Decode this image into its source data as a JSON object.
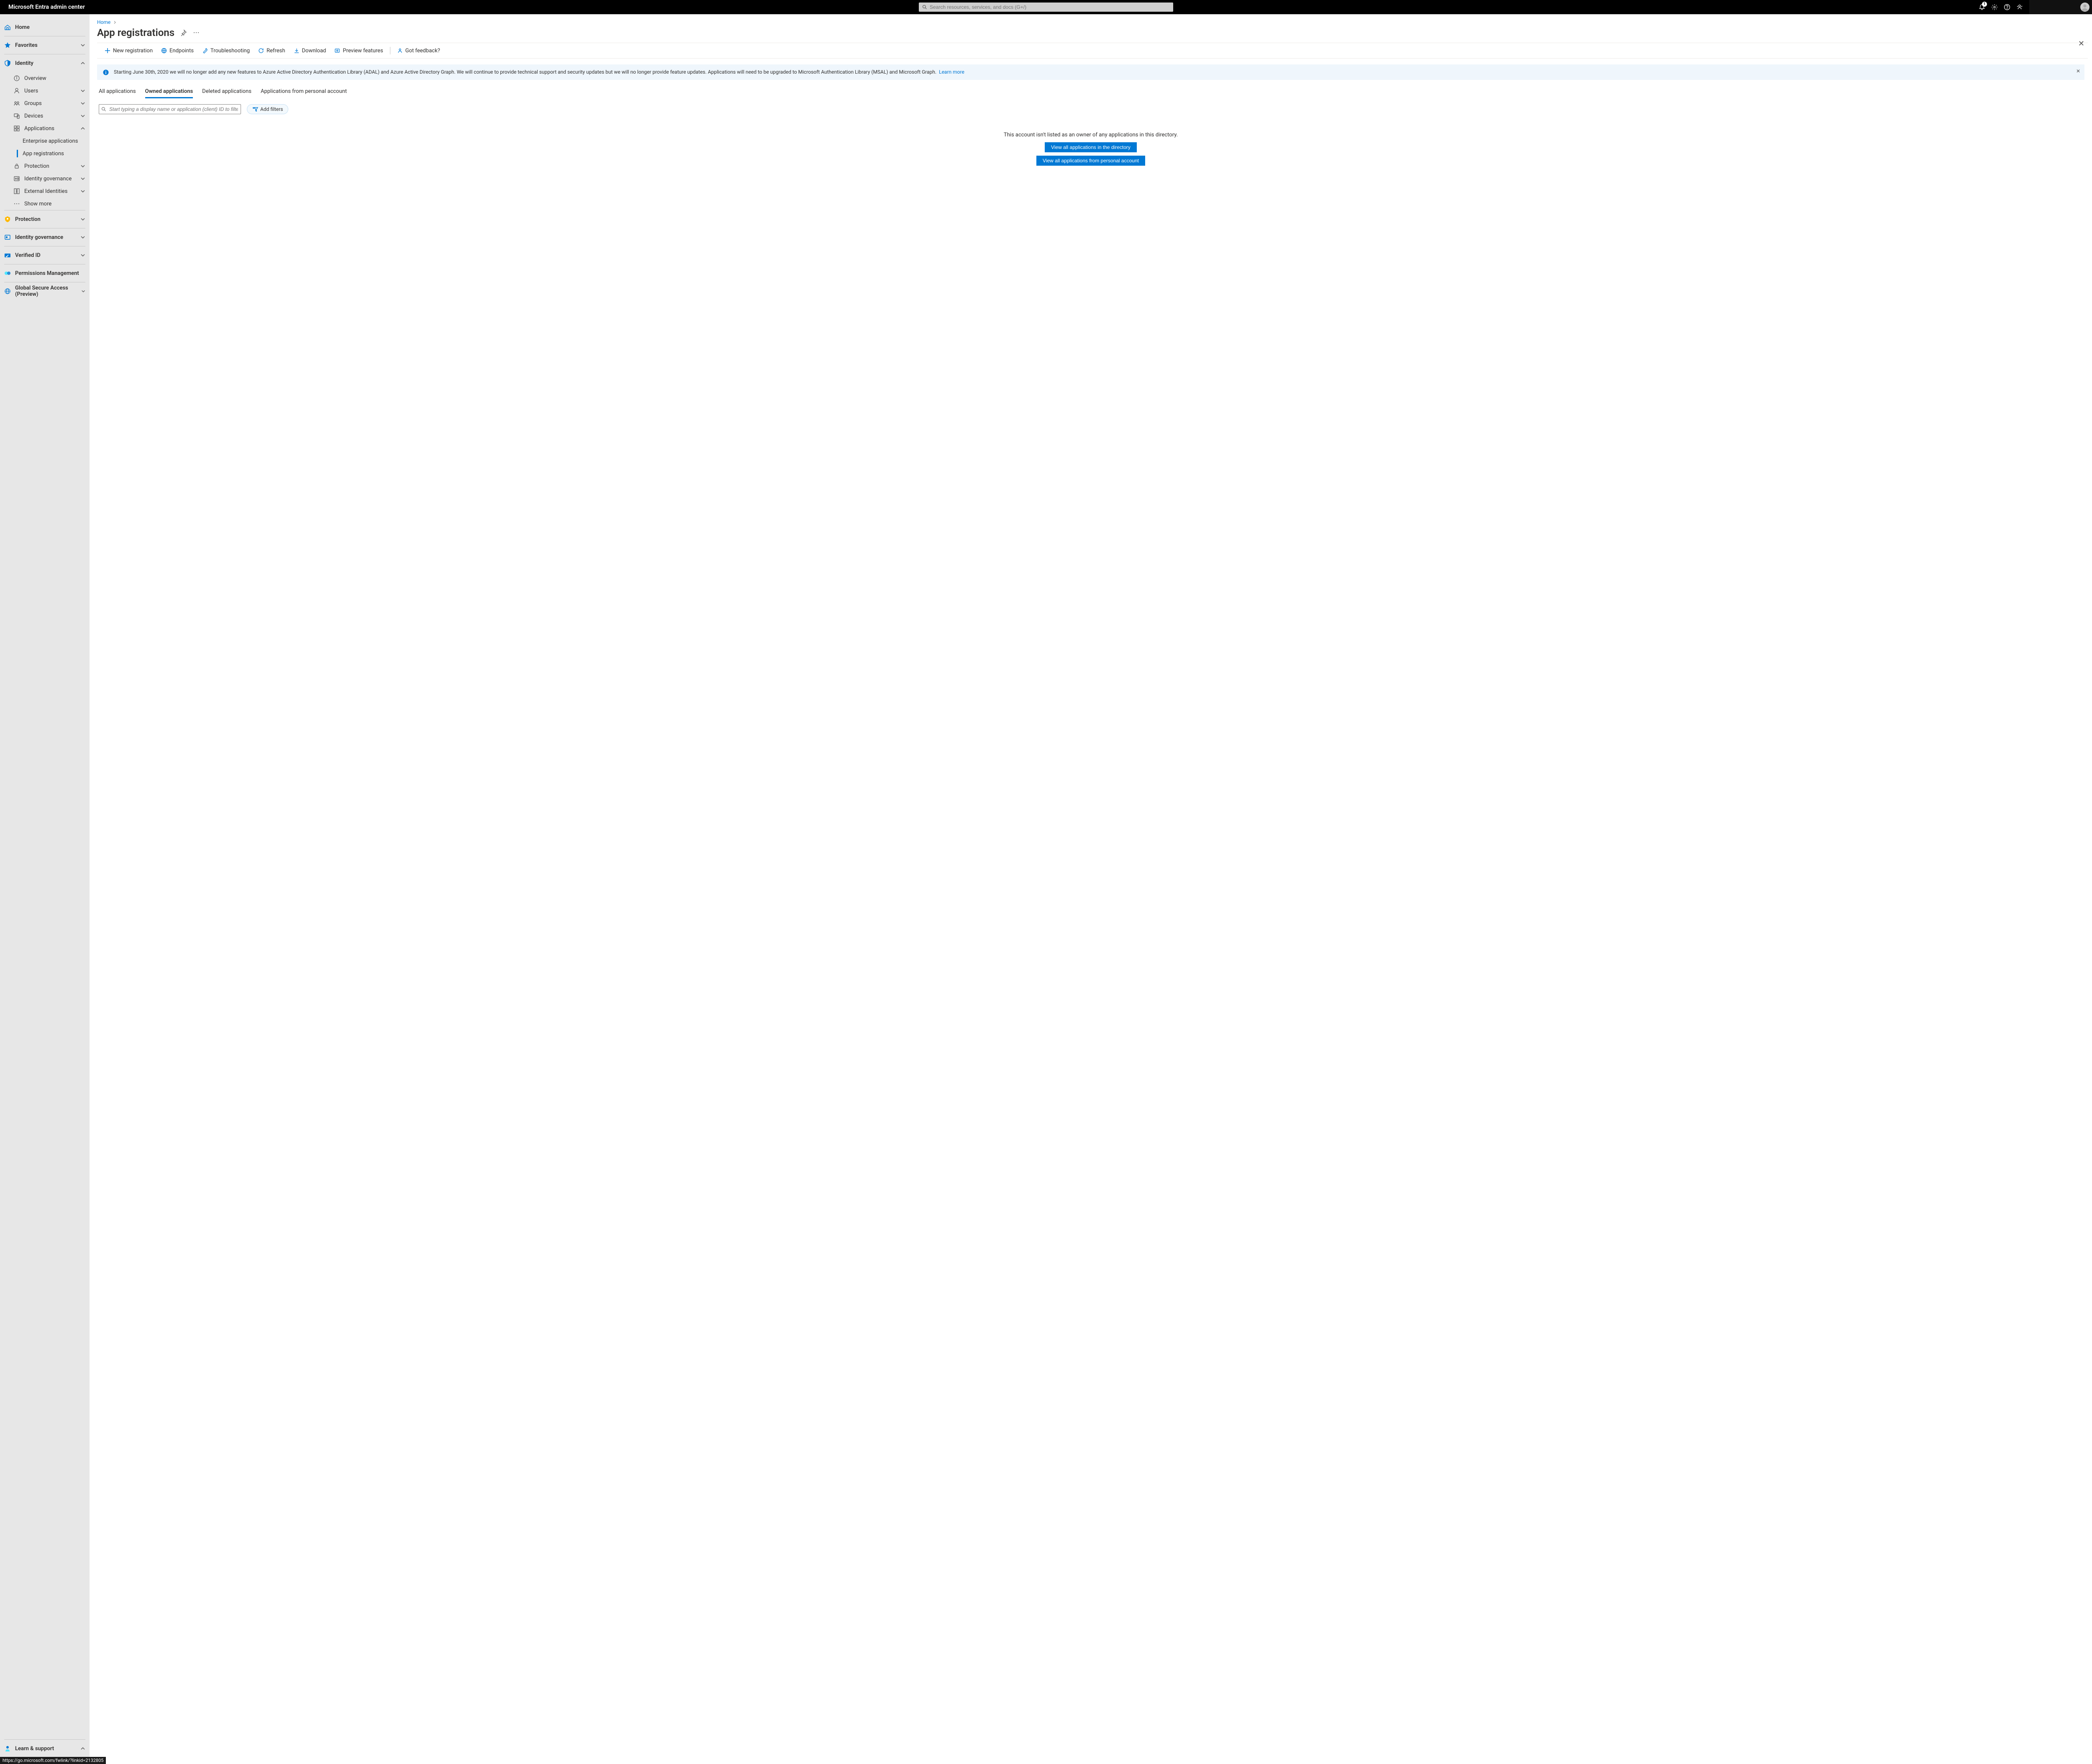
{
  "top": {
    "brand": "Microsoft Entra admin center",
    "search_placeholder": "Search resources, services, and docs (G+/)",
    "notification_badge": "1"
  },
  "sidebar": {
    "home": "Home",
    "favorites": "Favorites",
    "identity": {
      "label": "Identity",
      "overview": "Overview",
      "users": "Users",
      "groups": "Groups",
      "devices": "Devices",
      "applications": {
        "label": "Applications",
        "enterprise": "Enterprise applications",
        "app_reg": "App registrations"
      },
      "protection": "Protection",
      "id_gov": "Identity governance",
      "external": "External Identities",
      "show_more": "Show more"
    },
    "protection2": "Protection",
    "id_gov2": "Identity governance",
    "verified_id": "Verified ID",
    "perm_mgmt": "Permissions Management",
    "gsa": "Global Secure Access (Preview)",
    "learn": "Learn & support"
  },
  "breadcrumb": {
    "home": "Home"
  },
  "page": {
    "title": "App registrations"
  },
  "cmd": {
    "new_reg": "New registration",
    "endpoints": "Endpoints",
    "troubleshoot": "Troubleshooting",
    "refresh": "Refresh",
    "download": "Download",
    "preview": "Preview features",
    "feedback": "Got feedback?"
  },
  "info": {
    "text": "Starting June 30th, 2020 we will no longer add any new features to Azure Active Directory Authentication Library (ADAL) and Azure Active Directory Graph. We will continue to provide technical support and security updates but we will no longer provide feature updates. Applications will need to be upgraded to Microsoft Authentication Library (MSAL) and Microsoft Graph.",
    "learn_more": "Learn more"
  },
  "tabs": {
    "all": "All applications",
    "owned": "Owned applications",
    "deleted": "Deleted applications",
    "personal": "Applications from personal account"
  },
  "filter": {
    "placeholder": "Start typing a display name or application (client) ID to filter these r...",
    "add": "Add filters"
  },
  "empty": {
    "msg": "This account isn't listed as an owner of any applications in this directory.",
    "btn1": "View all applications in the directory",
    "btn2": "View all applications from personal account"
  },
  "status_url": "https://go.microsoft.com/fwlink/?linkid=2132805"
}
